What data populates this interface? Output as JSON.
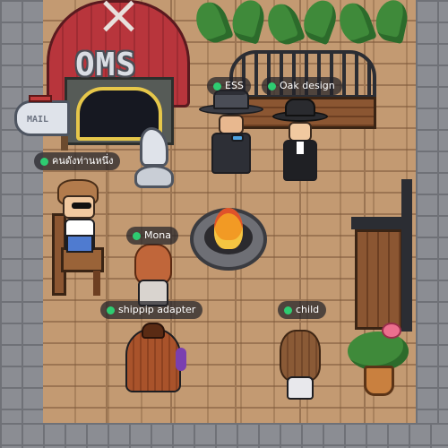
{
  "barn": {
    "sign": "OMS"
  },
  "mailbox": {
    "label": "MAIL"
  },
  "status_color": "#2ecc71",
  "players": [
    {
      "name": "ESS"
    },
    {
      "name": "Oak design"
    },
    {
      "name": "คนดังท่านหนึ่ง"
    },
    {
      "name": "Mona"
    },
    {
      "name": "shippip adapter"
    },
    {
      "name": "child"
    }
  ]
}
